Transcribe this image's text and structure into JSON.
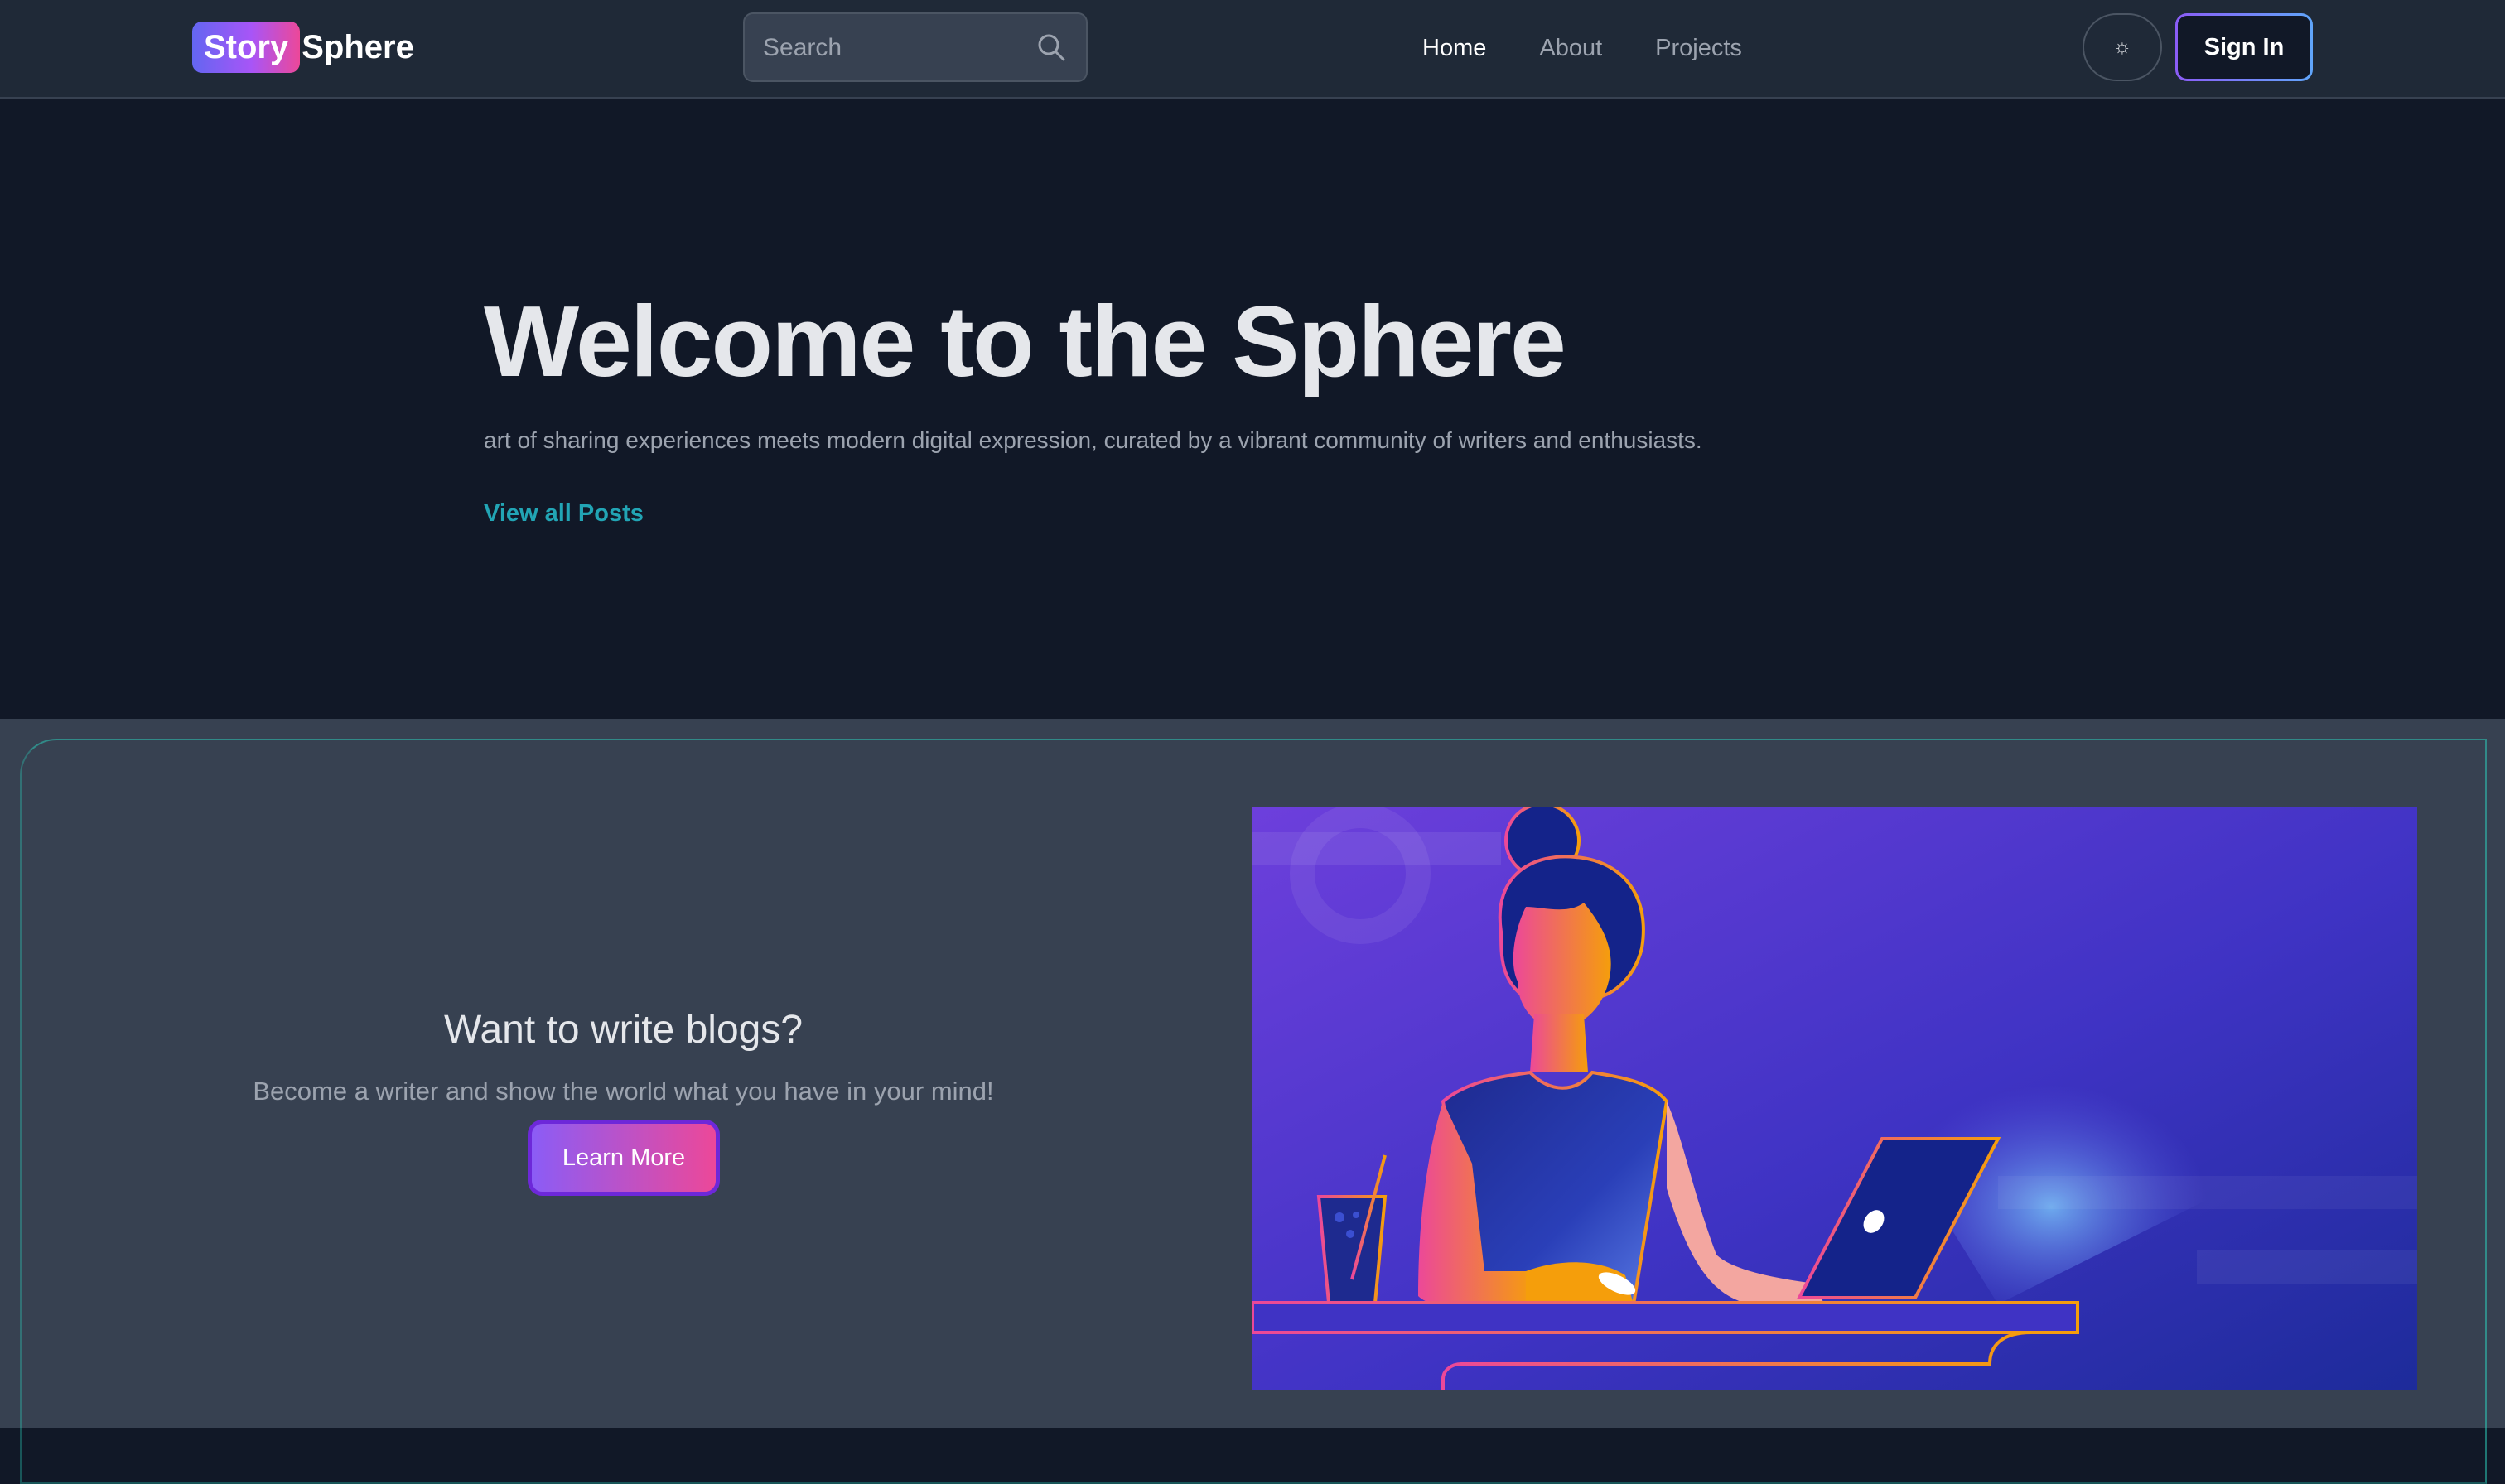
{
  "header": {
    "brand_highlight": "Story",
    "brand_rest": "Sphere",
    "search_placeholder": "Search",
    "nav": [
      {
        "label": "Home",
        "active": true
      },
      {
        "label": "About",
        "active": false
      },
      {
        "label": "Projects",
        "active": false
      }
    ],
    "theme_icon": "sun-icon",
    "theme_glyph": "☼",
    "signin_label": "Sign In"
  },
  "hero": {
    "title": "Welcome to the Sphere",
    "subtitle": "art of sharing experiences meets modern digital expression, curated by a vibrant community of writers and enthusiasts.",
    "link_label": "View all Posts"
  },
  "cta": {
    "title": "Want to write blogs?",
    "subtitle": "Become a writer and show the world what you have in your mind!",
    "button_label": "Learn More",
    "illustration": "woman-writing-on-laptop-illustration"
  },
  "colors": {
    "nav_bg": "#1f2937",
    "hero_bg": "#111827",
    "section_bg": "#374151",
    "accent_link": "#22a5b5",
    "brand_gradient_start": "#6366f1",
    "brand_gradient_end": "#ec4899"
  }
}
